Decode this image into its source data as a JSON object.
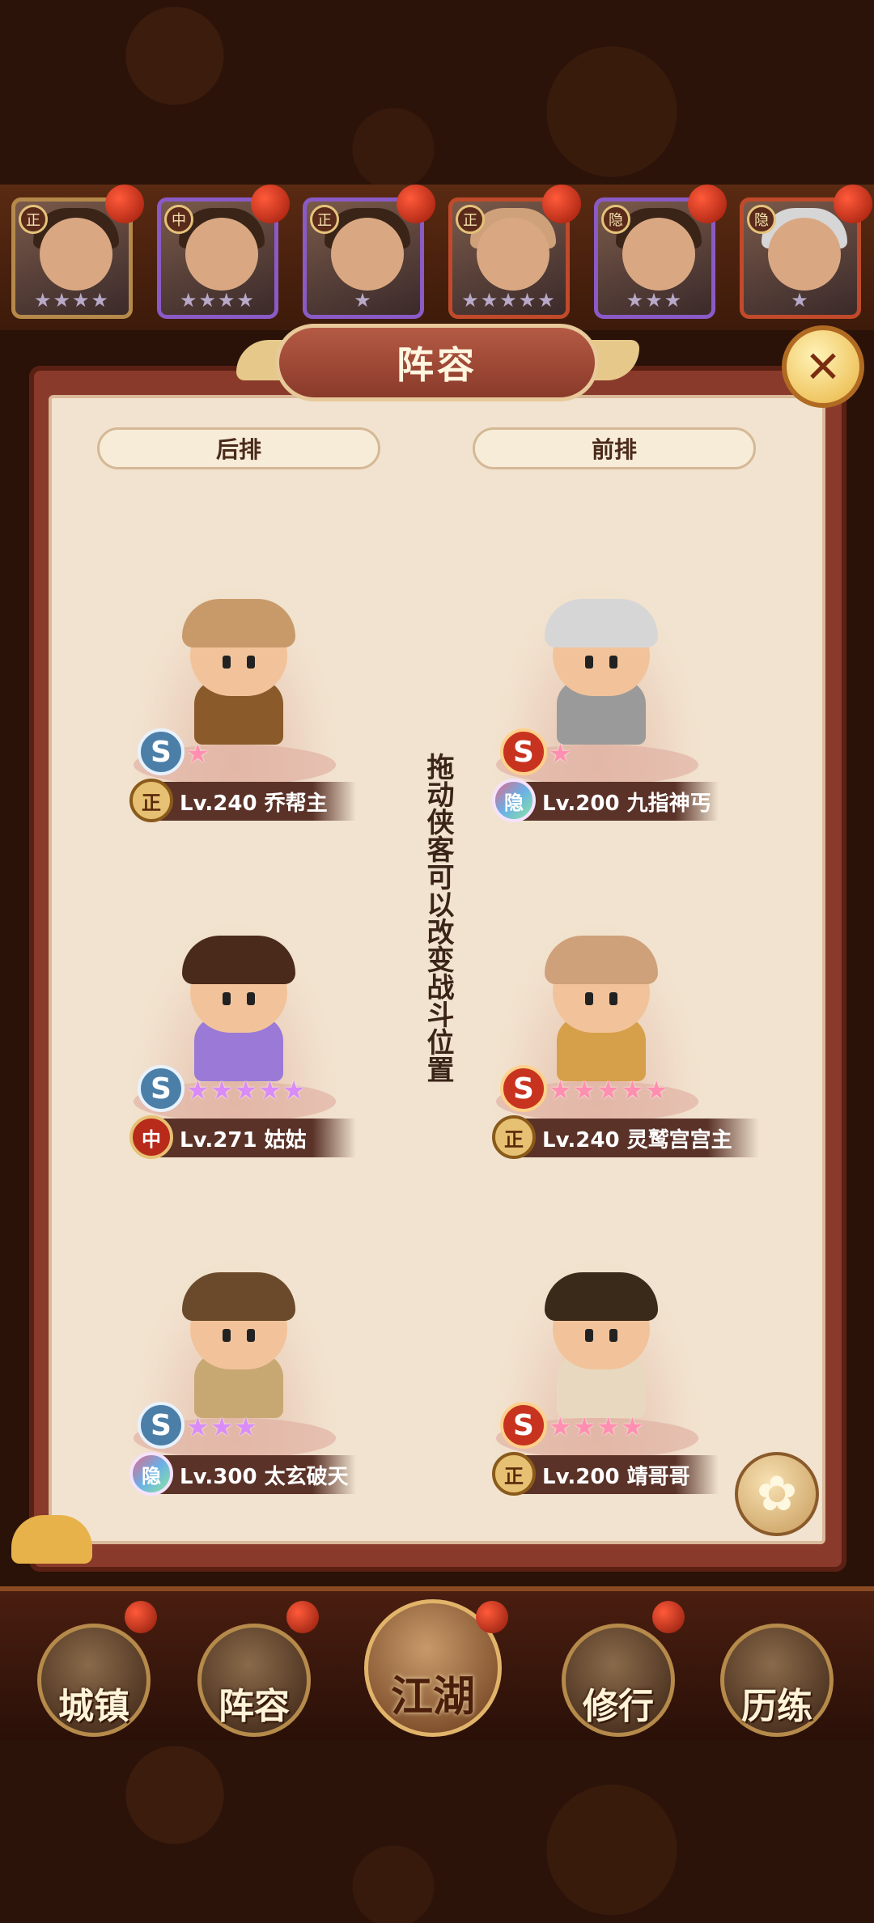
{
  "panel": {
    "title": "阵容",
    "close_icon": "close-x-icon",
    "back_row_label": "后排",
    "front_row_label": "前排",
    "hint": "拖动侠客可以改变战斗位置"
  },
  "roster": [
    {
      "faction": "正",
      "stars": "★★★★",
      "color": "#b5894a"
    },
    {
      "faction": "中",
      "stars": "★★★★",
      "color": "#8a5ac6"
    },
    {
      "faction": "正",
      "stars": "★",
      "color": "#8a5ac6"
    },
    {
      "faction": "正",
      "stars": "★★★★★",
      "color": "#c04a2a"
    },
    {
      "faction": "隐",
      "stars": "★★★",
      "color": "#8a5ac6"
    },
    {
      "faction": "隐",
      "stars": "★",
      "color": "#c04a2a"
    }
  ],
  "back_row": [
    {
      "faction": "正",
      "level_name": "Lv.240 乔帮主",
      "rank": "S",
      "stars": "★"
    },
    {
      "faction": "中",
      "level_name": "Lv.271 姑姑",
      "rank": "S",
      "stars": "★★★★★"
    },
    {
      "faction": "隐",
      "level_name": "Lv.300 太玄破天",
      "rank": "S",
      "stars": "★★★"
    }
  ],
  "front_row": [
    {
      "faction": "隐",
      "level_name": "Lv.200 九指神丐",
      "rank": "S",
      "stars": "★"
    },
    {
      "faction": "正",
      "level_name": "Lv.240 灵鹫宫宫主",
      "rank": "S",
      "stars": "★★★★★"
    },
    {
      "faction": "正",
      "level_name": "Lv.200 靖哥哥",
      "rank": "S",
      "stars": "★★★★"
    }
  ],
  "nav": {
    "town": "城镇",
    "lineup": "阵容",
    "jianghu": "江湖",
    "training": "修行",
    "trial": "历练"
  }
}
